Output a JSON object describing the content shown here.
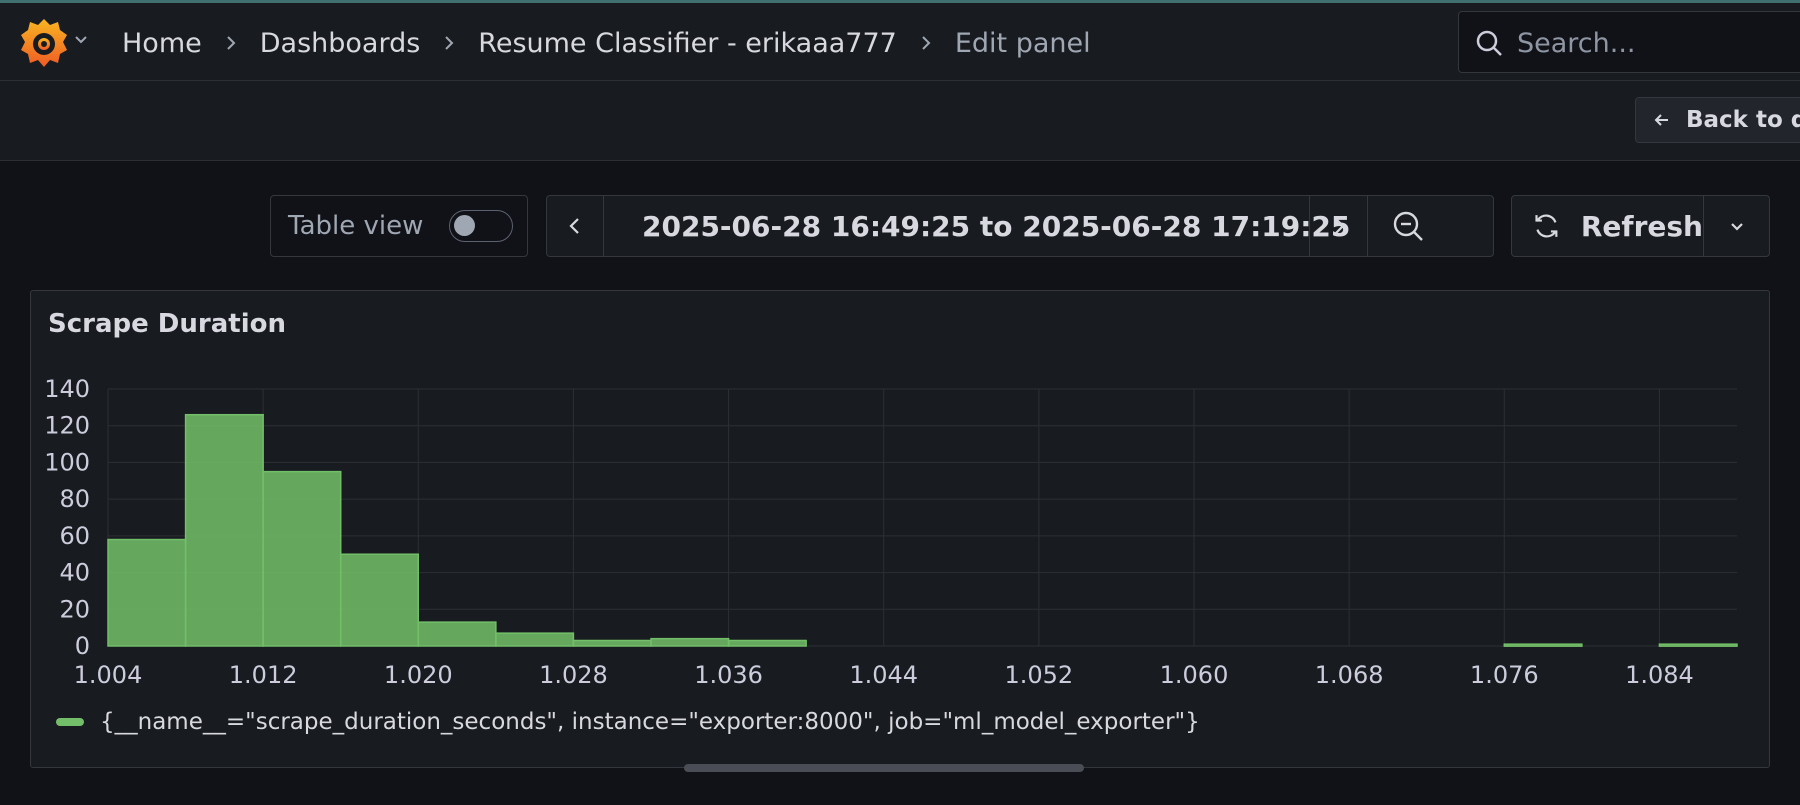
{
  "breadcrumb": {
    "items": [
      "Home",
      "Dashboards",
      "Resume Classifier - erikaaa777"
    ],
    "current": "Edit panel"
  },
  "search": {
    "placeholder": "Search..."
  },
  "toolbar": {
    "back_label": "Back to da"
  },
  "controls": {
    "table_view_label": "Table view",
    "table_view_on": false,
    "time_range": "2025-06-28 16:49:25 to 2025-06-28 17:19:25",
    "refresh_label": "Refresh"
  },
  "panel": {
    "title": "Scrape Duration",
    "legend": "{__name__=\"scrape_duration_seconds\", instance=\"exporter:8000\", job=\"ml_model_exporter\"}"
  },
  "colors": {
    "series": "#73bf69",
    "background": "#111217",
    "panel": "#181b1f"
  },
  "chart_data": {
    "type": "bar",
    "subtype": "histogram",
    "bin_width": 0.004,
    "bins": [
      {
        "start": 1.004,
        "end": 1.008,
        "count": 58
      },
      {
        "start": 1.008,
        "end": 1.012,
        "count": 126
      },
      {
        "start": 1.012,
        "end": 1.016,
        "count": 95
      },
      {
        "start": 1.016,
        "end": 1.02,
        "count": 50
      },
      {
        "start": 1.02,
        "end": 1.024,
        "count": 13
      },
      {
        "start": 1.024,
        "end": 1.028,
        "count": 7
      },
      {
        "start": 1.028,
        "end": 1.032,
        "count": 3
      },
      {
        "start": 1.032,
        "end": 1.036,
        "count": 4
      },
      {
        "start": 1.036,
        "end": 1.04,
        "count": 3
      },
      {
        "start": 1.076,
        "end": 1.08,
        "count": 1
      },
      {
        "start": 1.084,
        "end": 1.088,
        "count": 1
      }
    ],
    "xlim": [
      1.004,
      1.088
    ],
    "ylim": [
      0,
      140
    ],
    "x_ticks": [
      "1.004",
      "1.012",
      "1.020",
      "1.028",
      "1.036",
      "1.044",
      "1.052",
      "1.060",
      "1.068",
      "1.076",
      "1.084"
    ],
    "y_ticks": [
      "0",
      "20",
      "40",
      "60",
      "80",
      "100",
      "120",
      "140"
    ],
    "grid": true,
    "legend_position": "bottom-left",
    "series": [
      {
        "name": "{__name__=\"scrape_duration_seconds\", instance=\"exporter:8000\", job=\"ml_model_exporter\"}"
      }
    ]
  }
}
